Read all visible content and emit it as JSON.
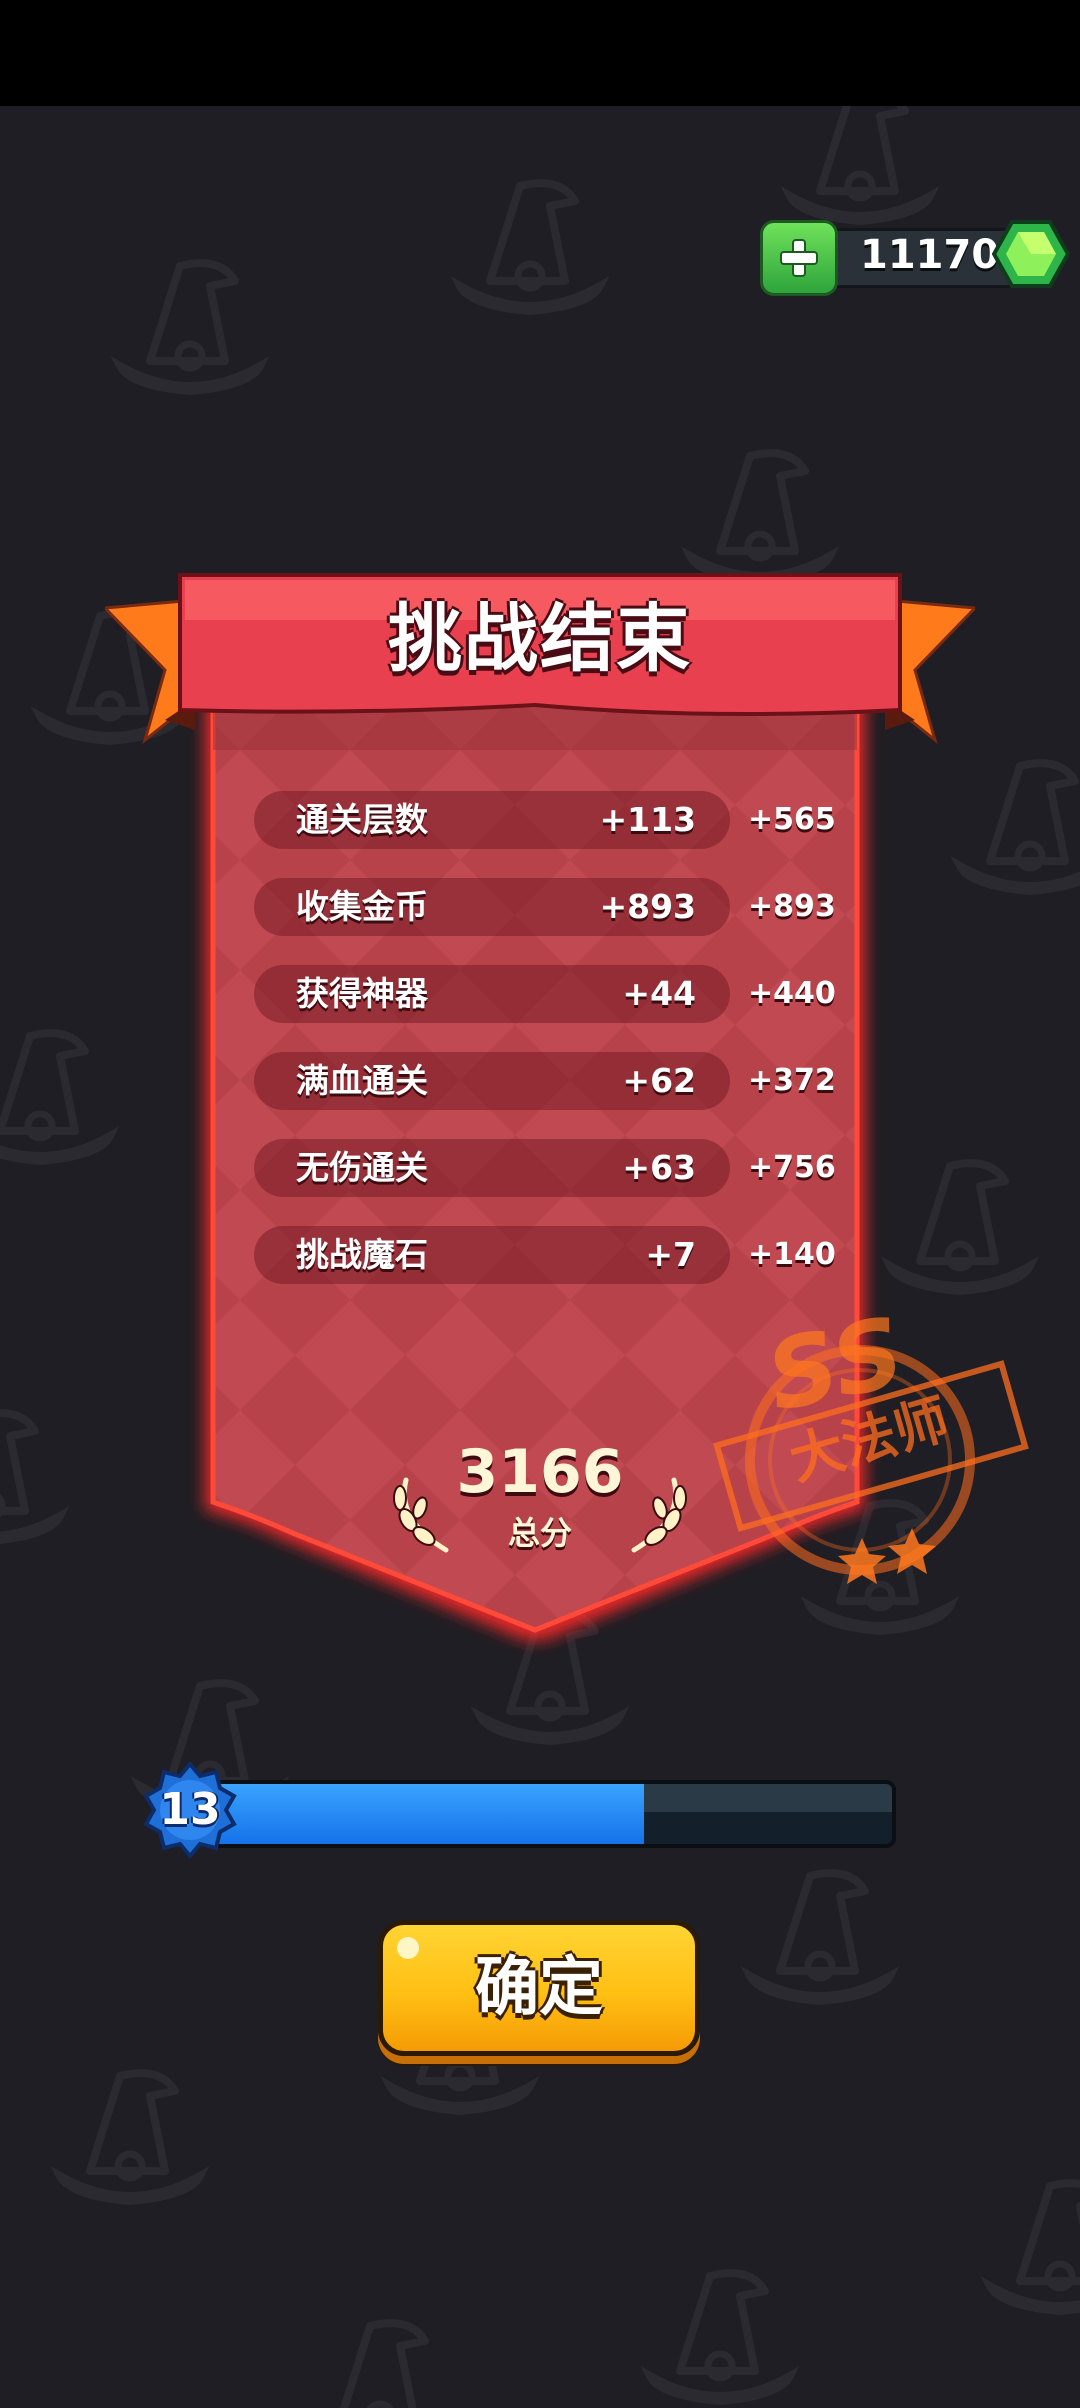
{
  "currency": {
    "gems": "11170",
    "plus_icon": "plus-icon",
    "gem_icon": "green-gem-icon"
  },
  "result": {
    "title": "挑战结束",
    "rows": [
      {
        "label": "通关层数",
        "count": "+113",
        "points": "+565"
      },
      {
        "label": "收集金币",
        "count": "+893",
        "points": "+893"
      },
      {
        "label": "获得神器",
        "count": "+44",
        "points": "+440"
      },
      {
        "label": "满血通关",
        "count": "+62",
        "points": "+372"
      },
      {
        "label": "无伤通关",
        "count": "+63",
        "points": "+756"
      },
      {
        "label": "挑战魔石",
        "count": "+7",
        "points": "+140"
      }
    ],
    "total_score": "3166",
    "total_label": "总分",
    "rank_grade": "SS",
    "rank_title": "大法师",
    "rank_stars": 2
  },
  "level": {
    "number": "13",
    "progress": 0.64
  },
  "confirm_label": "确定",
  "colors": {
    "banner_red": "#e8404f",
    "panel_red": "#b8424a",
    "level_blue": "#1f8bff",
    "button_yellow": "#ffc21a",
    "stamp_orange": "#ff7a1e"
  }
}
